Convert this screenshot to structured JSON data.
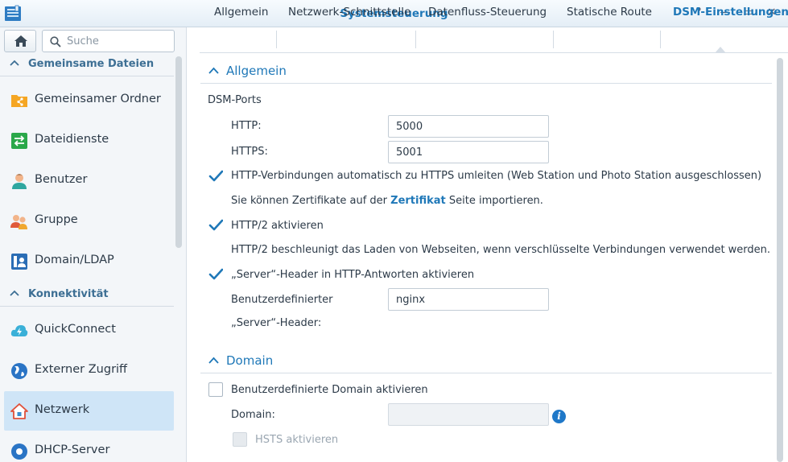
{
  "window": {
    "title": "Systemsteuerung",
    "help_glyph": "?",
    "min_glyph": "—",
    "max_glyph": "▭",
    "close_glyph": "✕"
  },
  "sidebar": {
    "search_placeholder": "Suche",
    "sections": [
      {
        "label": "Gemeinsame Dateien"
      },
      {
        "label": "Konnektivität"
      }
    ],
    "items": [
      {
        "label": "Gemeinsamer Ordner",
        "icon": "shared-folder-icon"
      },
      {
        "label": "Dateidienste",
        "icon": "file-services-icon"
      },
      {
        "label": "Benutzer",
        "icon": "user-icon"
      },
      {
        "label": "Gruppe",
        "icon": "group-icon"
      },
      {
        "label": "Domain/LDAP",
        "icon": "domain-ldap-icon"
      },
      {
        "label": "QuickConnect",
        "icon": "quickconnect-icon"
      },
      {
        "label": "Externer Zugriff",
        "icon": "globe-icon"
      },
      {
        "label": "Netzwerk",
        "icon": "network-house-icon",
        "active": true
      },
      {
        "label": "DHCP-Server",
        "icon": "dhcp-server-icon"
      }
    ]
  },
  "tabs": [
    {
      "label": "Allgemein"
    },
    {
      "label": "Netzwerk-Schnittstelle"
    },
    {
      "label": "Datenfluss-Steuerung"
    },
    {
      "label": "Statische Route"
    },
    {
      "label": "DSM-Einstellungen",
      "active": true
    }
  ],
  "general": {
    "heading": "Allgemein",
    "ports_label": "DSM-Ports",
    "http_label": "HTTP:",
    "http_value": "5000",
    "https_label": "HTTPS:",
    "https_value": "5001",
    "redirect_label": "HTTP-Verbindungen automatisch zu HTTPS umleiten (Web Station und Photo Station ausgeschlossen)",
    "redirect_checked": true,
    "cert_text_before": "Sie können Zertifikate auf der ",
    "cert_link": "Zertifikat",
    "cert_text_after": " Seite importieren.",
    "http2_label": "HTTP/2 aktivieren",
    "http2_checked": true,
    "http2_desc": "HTTP/2 beschleunigt das Laden von Webseiten, wenn verschlüsselte Verbindungen verwendet werden.",
    "server_header_label": "„Server“-Header in HTTP-Antworten aktivieren",
    "server_header_checked": true,
    "custom_header_label_1": "Benutzerdefinierter",
    "custom_header_label_2": "„Server“-Header:",
    "custom_header_value": "nginx"
  },
  "domain": {
    "heading": "Domain",
    "custom_domain_label": "Benutzerdefinierte Domain aktivieren",
    "custom_domain_checked": false,
    "domain_label": "Domain:",
    "domain_value": "",
    "hsts_label": "HSTS aktivieren",
    "hsts_checked": false,
    "info_glyph": "i"
  },
  "colors": {
    "accent": "#1f78b8",
    "active_item_bg": "#cfe5f7",
    "sidebar_bg": "#f3f6f9"
  }
}
